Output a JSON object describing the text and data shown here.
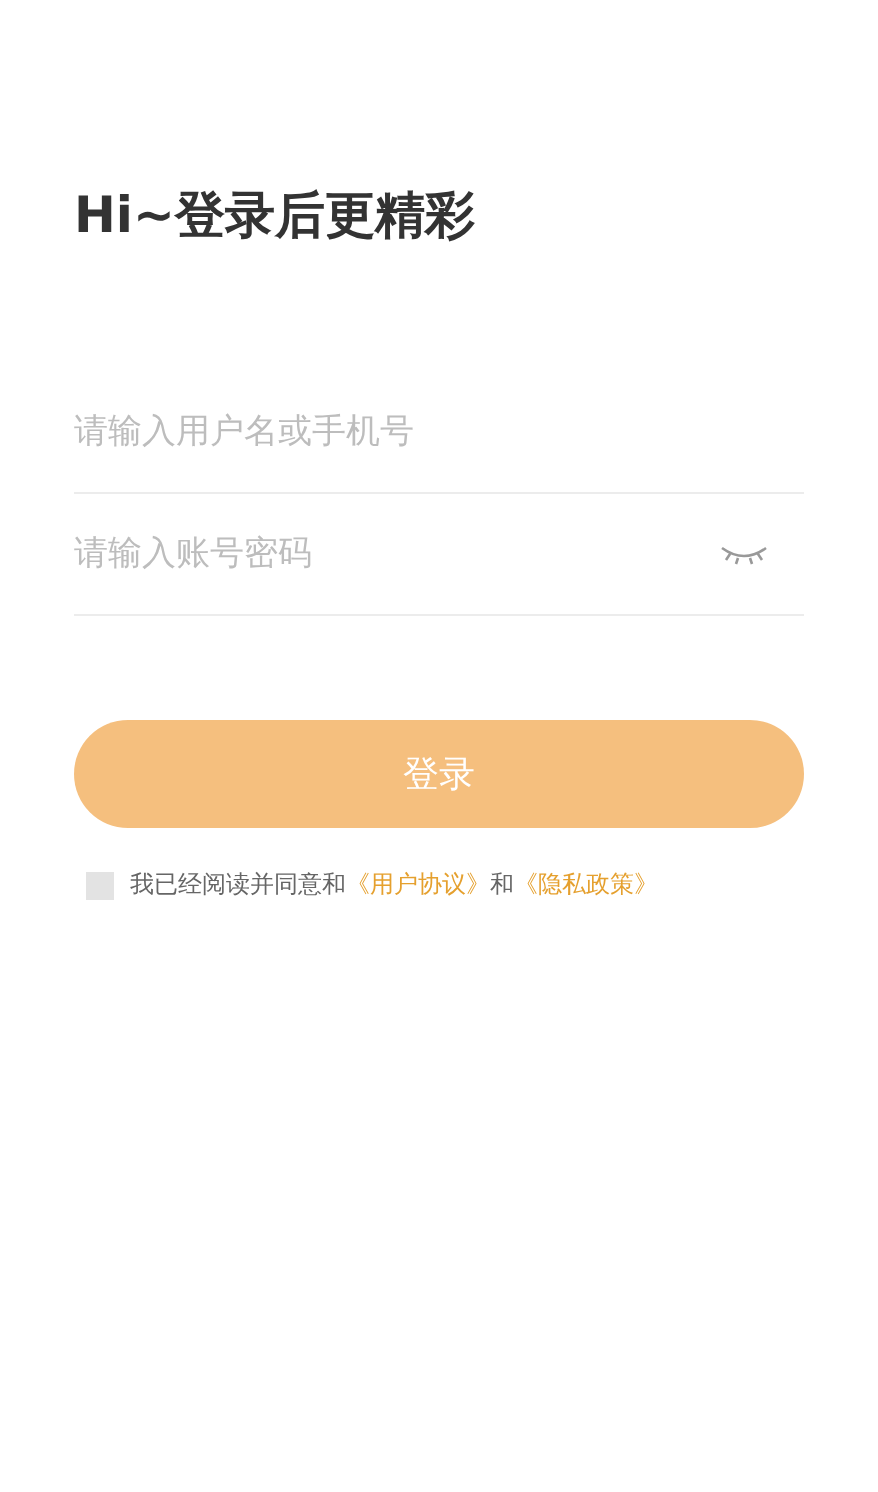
{
  "title": "Hi~登录后更精彩",
  "fields": [
    {
      "kind": "text",
      "placeholder": "请输入用户名或手机号"
    },
    {
      "kind": "password",
      "placeholder": "请输入账号密码"
    }
  ],
  "login_button": "登录",
  "agreement": {
    "checked": false,
    "parts": [
      {
        "kind": "text",
        "text": "我已经阅读并同意和"
      },
      {
        "kind": "link",
        "text": "《用户协议》"
      },
      {
        "kind": "text",
        "text": "和"
      },
      {
        "kind": "link",
        "text": "《隐私政策》"
      }
    ]
  }
}
